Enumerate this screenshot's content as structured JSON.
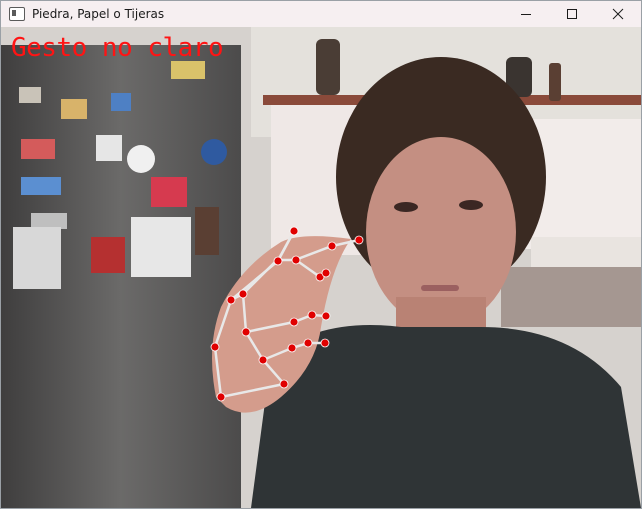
{
  "window": {
    "title": "Piedra, Papel o Tijeras",
    "icon": "app-window-icon",
    "controls": [
      "minimize-icon",
      "maximize-icon",
      "close-icon"
    ]
  },
  "camera": {
    "status_text": "Gesto no claro",
    "status_color": "#ff1414",
    "landmark_color": "#e00000",
    "connection_color": "#e8e8e8"
  }
}
